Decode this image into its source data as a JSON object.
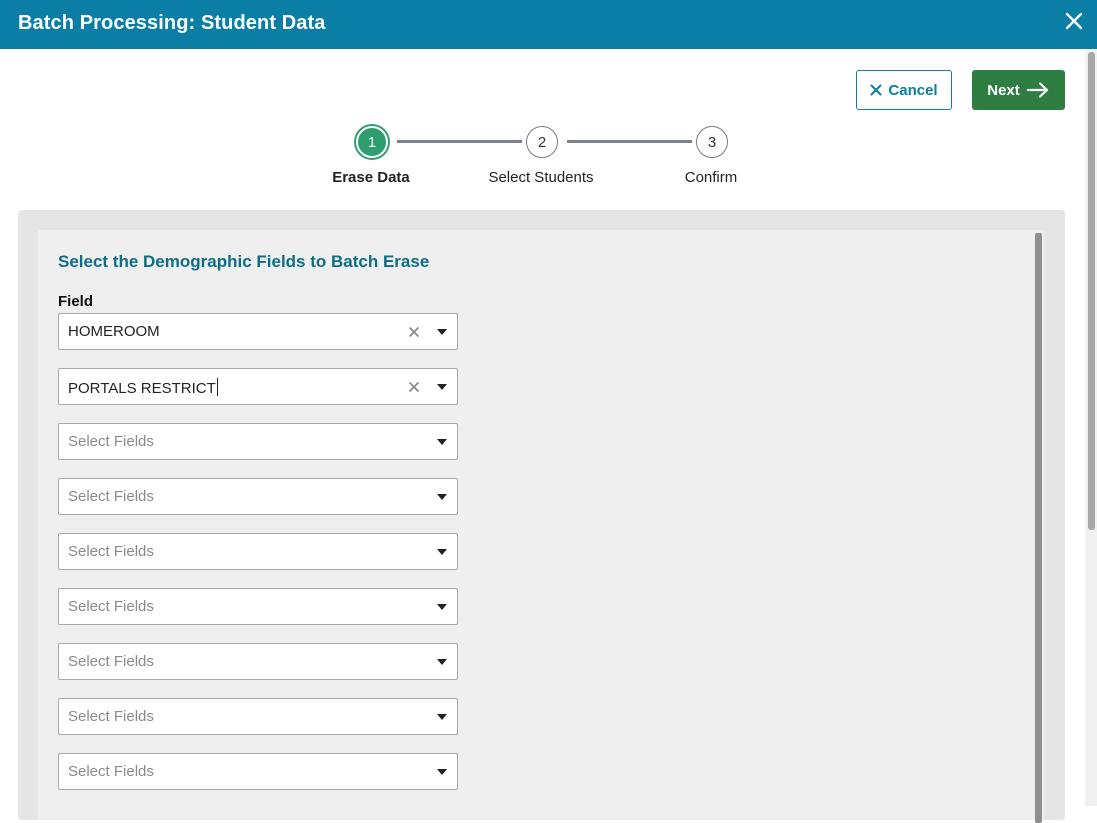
{
  "window": {
    "title": "Batch Processing: Student Data",
    "close_icon": "close-icon"
  },
  "toolbar": {
    "cancel_label": "Cancel",
    "cancel_icon": "x-icon",
    "next_label": "Next",
    "next_icon": "arrow-right-icon"
  },
  "stepper": {
    "steps": [
      {
        "number": "1",
        "label": "Erase Data",
        "active": true
      },
      {
        "number": "2",
        "label": "Select Students",
        "active": false
      },
      {
        "number": "3",
        "label": "Confirm",
        "active": false
      }
    ]
  },
  "form": {
    "section_title": "Select the Demographic Fields to Batch Erase",
    "field_label": "Field",
    "selects": [
      {
        "value": "HOMEROOM",
        "placeholder": "Select Fields"
      },
      {
        "value": "PORTALS RESTRICT",
        "placeholder": "Select Fields"
      },
      {
        "value": "",
        "placeholder": "Select Fields"
      },
      {
        "value": "",
        "placeholder": "Select Fields"
      },
      {
        "value": "",
        "placeholder": "Select Fields"
      },
      {
        "value": "",
        "placeholder": "Select Fields"
      },
      {
        "value": "",
        "placeholder": "Select Fields"
      },
      {
        "value": "",
        "placeholder": "Select Fields"
      },
      {
        "value": "",
        "placeholder": "Select Fields"
      }
    ]
  },
  "colors": {
    "header": "#0a7ea4",
    "next_button": "#2e7d41",
    "active_step": "#2f9e6f",
    "section_title": "#0e6d86"
  }
}
